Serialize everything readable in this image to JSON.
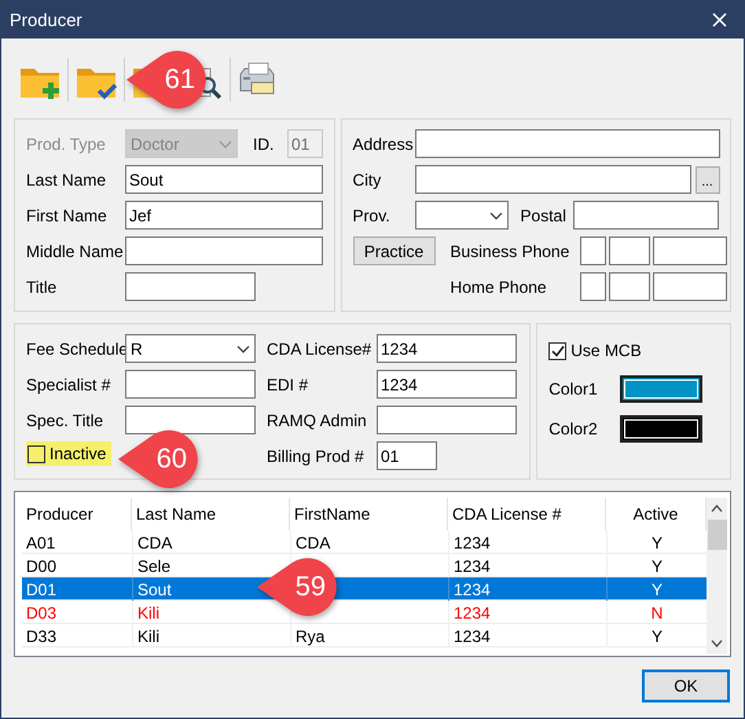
{
  "window": {
    "title": "Producer"
  },
  "toolbar": [
    {
      "kind": "folder-add"
    },
    {
      "kind": "folder-check"
    },
    {
      "kind": "preview"
    },
    {
      "kind": "print"
    }
  ],
  "identity": {
    "prod_type": {
      "label": "Prod. Type",
      "value": "Doctor",
      "disabled": true
    },
    "id": {
      "label": "ID.",
      "value": "01"
    },
    "fields": [
      {
        "label": "Last Name",
        "value": "Sout"
      },
      {
        "label": "First Name",
        "value": "Jef"
      },
      {
        "label": "Middle Name"
      },
      {
        "label": "Title"
      }
    ]
  },
  "address": {
    "address": {
      "label": "Address"
    },
    "city": {
      "label": "City",
      "browse": "..."
    },
    "prov": {
      "label": "Prov."
    },
    "postal": {
      "label": "Postal"
    },
    "practice_button": "Practice",
    "business_phone": {
      "label": "Business Phone"
    },
    "home_phone": {
      "label": "Home Phone"
    }
  },
  "billing": {
    "fee_schedule": {
      "label": "Fee Schedule",
      "value": "R"
    },
    "specialist": {
      "label": "Specialist #"
    },
    "spec_title": {
      "label": "Spec. Title"
    },
    "inactive": {
      "label": "Inactive",
      "checked": false,
      "highlighted": true
    },
    "cda_license": {
      "label": "CDA License#",
      "value": "1234"
    },
    "edi": {
      "label": "EDI #",
      "value": "1234"
    },
    "ramq": {
      "label": "RAMQ Admin"
    },
    "billing_prod": {
      "label": "Billing Prod #",
      "value": "01"
    }
  },
  "mcb": {
    "use_mcb": {
      "label": "Use MCB",
      "checked": true
    },
    "colors": [
      {
        "label": "Color1",
        "color": "#0093c4"
      },
      {
        "label": "Color2",
        "color": "#000000"
      }
    ]
  },
  "table": {
    "columns": [
      "Producer",
      "Last Name",
      "FirstName",
      "CDA License #",
      "Active"
    ],
    "rows": [
      {
        "cells": [
          "A01",
          "CDA",
          "CDA",
          "1234",
          "Y"
        ],
        "selected": false,
        "inactive": false
      },
      {
        "cells": [
          "D00",
          "Sele",
          null,
          "1234",
          "Y"
        ],
        "selected": false,
        "inactive": false
      },
      {
        "cells": [
          "D01",
          "Sout",
          null,
          "1234",
          "Y"
        ],
        "selected": true,
        "inactive": false
      },
      {
        "cells": [
          "D03",
          "Kili",
          null,
          "1234",
          "N"
        ],
        "selected": false,
        "inactive": true
      },
      {
        "cells": [
          "D33",
          "Kili",
          "Rya",
          "1234",
          "Y"
        ],
        "selected": false,
        "inactive": false
      }
    ]
  },
  "callouts": [
    {
      "number": "61"
    },
    {
      "number": "60"
    },
    {
      "number": "59"
    }
  ],
  "ok_button": "OK"
}
